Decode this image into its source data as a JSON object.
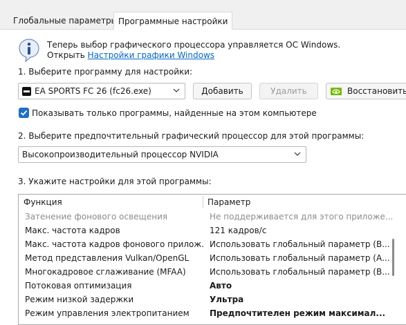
{
  "tabs": {
    "global": "Глобальные параметры",
    "program": "Программные настройки"
  },
  "info": {
    "line1": "Теперь выбор графического процессора управляется ОС Windows.",
    "open_prefix": "Открыть",
    "link": "Настройки графики Windows"
  },
  "step1": {
    "label": "1. Выберите программу для настройки:",
    "program_value": "EA SPORTS FC 26 (fc26.exe)",
    "add_button": "Добавить",
    "remove_button": "Удалить",
    "restore_button": "Восстановить"
  },
  "checkbox": {
    "label": "Показывать только программы, найденные на этом компьютере",
    "checked": true
  },
  "step2": {
    "label": "2. Выберите предпочтительный графический процессор для этой программы:",
    "gpu_value": "Высокопроизводительный процессор NVIDIA"
  },
  "step3": {
    "label": "3. Укажите настройки для этой программы:",
    "col_function": "Функция",
    "col_param": "Параметр",
    "rows": [
      {
        "f": "Затенение фонового освещения",
        "p": "Не поддерживается для этого приложе..."
      },
      {
        "f": "Макс. частота кадров",
        "p": "121 кадров/с"
      },
      {
        "f": "Макс. частота кадров фонового прилож...",
        "p": "Использовать глобальный параметр (В..."
      },
      {
        "f": "Метод представления Vulkan/OpenGL",
        "p": "Использовать глобальный параметр (А..."
      },
      {
        "f": "Многокадровое сглаживание (MFAA)",
        "p": "Использовать глобальный параметр (В..."
      },
      {
        "f": "Потоковая оптимизация",
        "p": "Авто"
      },
      {
        "f": "Режим низкой задержки",
        "p": "Ультра"
      },
      {
        "f": "Режим управления электропитанием",
        "p": "Предпочтителен режим максимал..."
      }
    ]
  },
  "colors": {
    "accent": "#1f6fc5",
    "link": "#0066cc",
    "nvidia_green": "#76b900"
  }
}
